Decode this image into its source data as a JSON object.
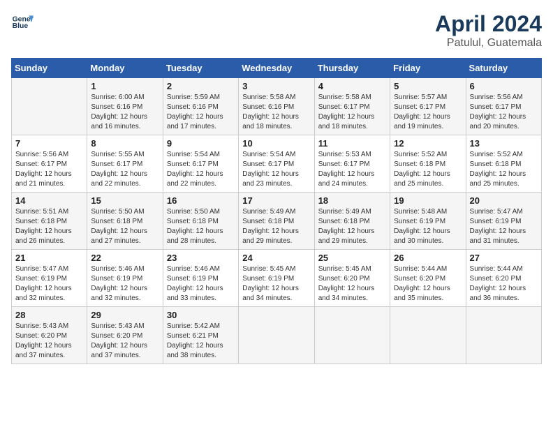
{
  "header": {
    "logo_line1": "General",
    "logo_line2": "Blue",
    "month": "April 2024",
    "location": "Patulul, Guatemala"
  },
  "days_of_week": [
    "Sunday",
    "Monday",
    "Tuesday",
    "Wednesday",
    "Thursday",
    "Friday",
    "Saturday"
  ],
  "weeks": [
    [
      {
        "day": "",
        "info": ""
      },
      {
        "day": "1",
        "info": "Sunrise: 6:00 AM\nSunset: 6:16 PM\nDaylight: 12 hours\nand 16 minutes."
      },
      {
        "day": "2",
        "info": "Sunrise: 5:59 AM\nSunset: 6:16 PM\nDaylight: 12 hours\nand 17 minutes."
      },
      {
        "day": "3",
        "info": "Sunrise: 5:58 AM\nSunset: 6:16 PM\nDaylight: 12 hours\nand 18 minutes."
      },
      {
        "day": "4",
        "info": "Sunrise: 5:58 AM\nSunset: 6:17 PM\nDaylight: 12 hours\nand 18 minutes."
      },
      {
        "day": "5",
        "info": "Sunrise: 5:57 AM\nSunset: 6:17 PM\nDaylight: 12 hours\nand 19 minutes."
      },
      {
        "day": "6",
        "info": "Sunrise: 5:56 AM\nSunset: 6:17 PM\nDaylight: 12 hours\nand 20 minutes."
      }
    ],
    [
      {
        "day": "7",
        "info": "Sunrise: 5:56 AM\nSunset: 6:17 PM\nDaylight: 12 hours\nand 21 minutes."
      },
      {
        "day": "8",
        "info": "Sunrise: 5:55 AM\nSunset: 6:17 PM\nDaylight: 12 hours\nand 22 minutes."
      },
      {
        "day": "9",
        "info": "Sunrise: 5:54 AM\nSunset: 6:17 PM\nDaylight: 12 hours\nand 22 minutes."
      },
      {
        "day": "10",
        "info": "Sunrise: 5:54 AM\nSunset: 6:17 PM\nDaylight: 12 hours\nand 23 minutes."
      },
      {
        "day": "11",
        "info": "Sunrise: 5:53 AM\nSunset: 6:17 PM\nDaylight: 12 hours\nand 24 minutes."
      },
      {
        "day": "12",
        "info": "Sunrise: 5:52 AM\nSunset: 6:18 PM\nDaylight: 12 hours\nand 25 minutes."
      },
      {
        "day": "13",
        "info": "Sunrise: 5:52 AM\nSunset: 6:18 PM\nDaylight: 12 hours\nand 25 minutes."
      }
    ],
    [
      {
        "day": "14",
        "info": "Sunrise: 5:51 AM\nSunset: 6:18 PM\nDaylight: 12 hours\nand 26 minutes."
      },
      {
        "day": "15",
        "info": "Sunrise: 5:50 AM\nSunset: 6:18 PM\nDaylight: 12 hours\nand 27 minutes."
      },
      {
        "day": "16",
        "info": "Sunrise: 5:50 AM\nSunset: 6:18 PM\nDaylight: 12 hours\nand 28 minutes."
      },
      {
        "day": "17",
        "info": "Sunrise: 5:49 AM\nSunset: 6:18 PM\nDaylight: 12 hours\nand 29 minutes."
      },
      {
        "day": "18",
        "info": "Sunrise: 5:49 AM\nSunset: 6:18 PM\nDaylight: 12 hours\nand 29 minutes."
      },
      {
        "day": "19",
        "info": "Sunrise: 5:48 AM\nSunset: 6:19 PM\nDaylight: 12 hours\nand 30 minutes."
      },
      {
        "day": "20",
        "info": "Sunrise: 5:47 AM\nSunset: 6:19 PM\nDaylight: 12 hours\nand 31 minutes."
      }
    ],
    [
      {
        "day": "21",
        "info": "Sunrise: 5:47 AM\nSunset: 6:19 PM\nDaylight: 12 hours\nand 32 minutes."
      },
      {
        "day": "22",
        "info": "Sunrise: 5:46 AM\nSunset: 6:19 PM\nDaylight: 12 hours\nand 32 minutes."
      },
      {
        "day": "23",
        "info": "Sunrise: 5:46 AM\nSunset: 6:19 PM\nDaylight: 12 hours\nand 33 minutes."
      },
      {
        "day": "24",
        "info": "Sunrise: 5:45 AM\nSunset: 6:19 PM\nDaylight: 12 hours\nand 34 minutes."
      },
      {
        "day": "25",
        "info": "Sunrise: 5:45 AM\nSunset: 6:20 PM\nDaylight: 12 hours\nand 34 minutes."
      },
      {
        "day": "26",
        "info": "Sunrise: 5:44 AM\nSunset: 6:20 PM\nDaylight: 12 hours\nand 35 minutes."
      },
      {
        "day": "27",
        "info": "Sunrise: 5:44 AM\nSunset: 6:20 PM\nDaylight: 12 hours\nand 36 minutes."
      }
    ],
    [
      {
        "day": "28",
        "info": "Sunrise: 5:43 AM\nSunset: 6:20 PM\nDaylight: 12 hours\nand 37 minutes."
      },
      {
        "day": "29",
        "info": "Sunrise: 5:43 AM\nSunset: 6:20 PM\nDaylight: 12 hours\nand 37 minutes."
      },
      {
        "day": "30",
        "info": "Sunrise: 5:42 AM\nSunset: 6:21 PM\nDaylight: 12 hours\nand 38 minutes."
      },
      {
        "day": "",
        "info": ""
      },
      {
        "day": "",
        "info": ""
      },
      {
        "day": "",
        "info": ""
      },
      {
        "day": "",
        "info": ""
      }
    ]
  ]
}
